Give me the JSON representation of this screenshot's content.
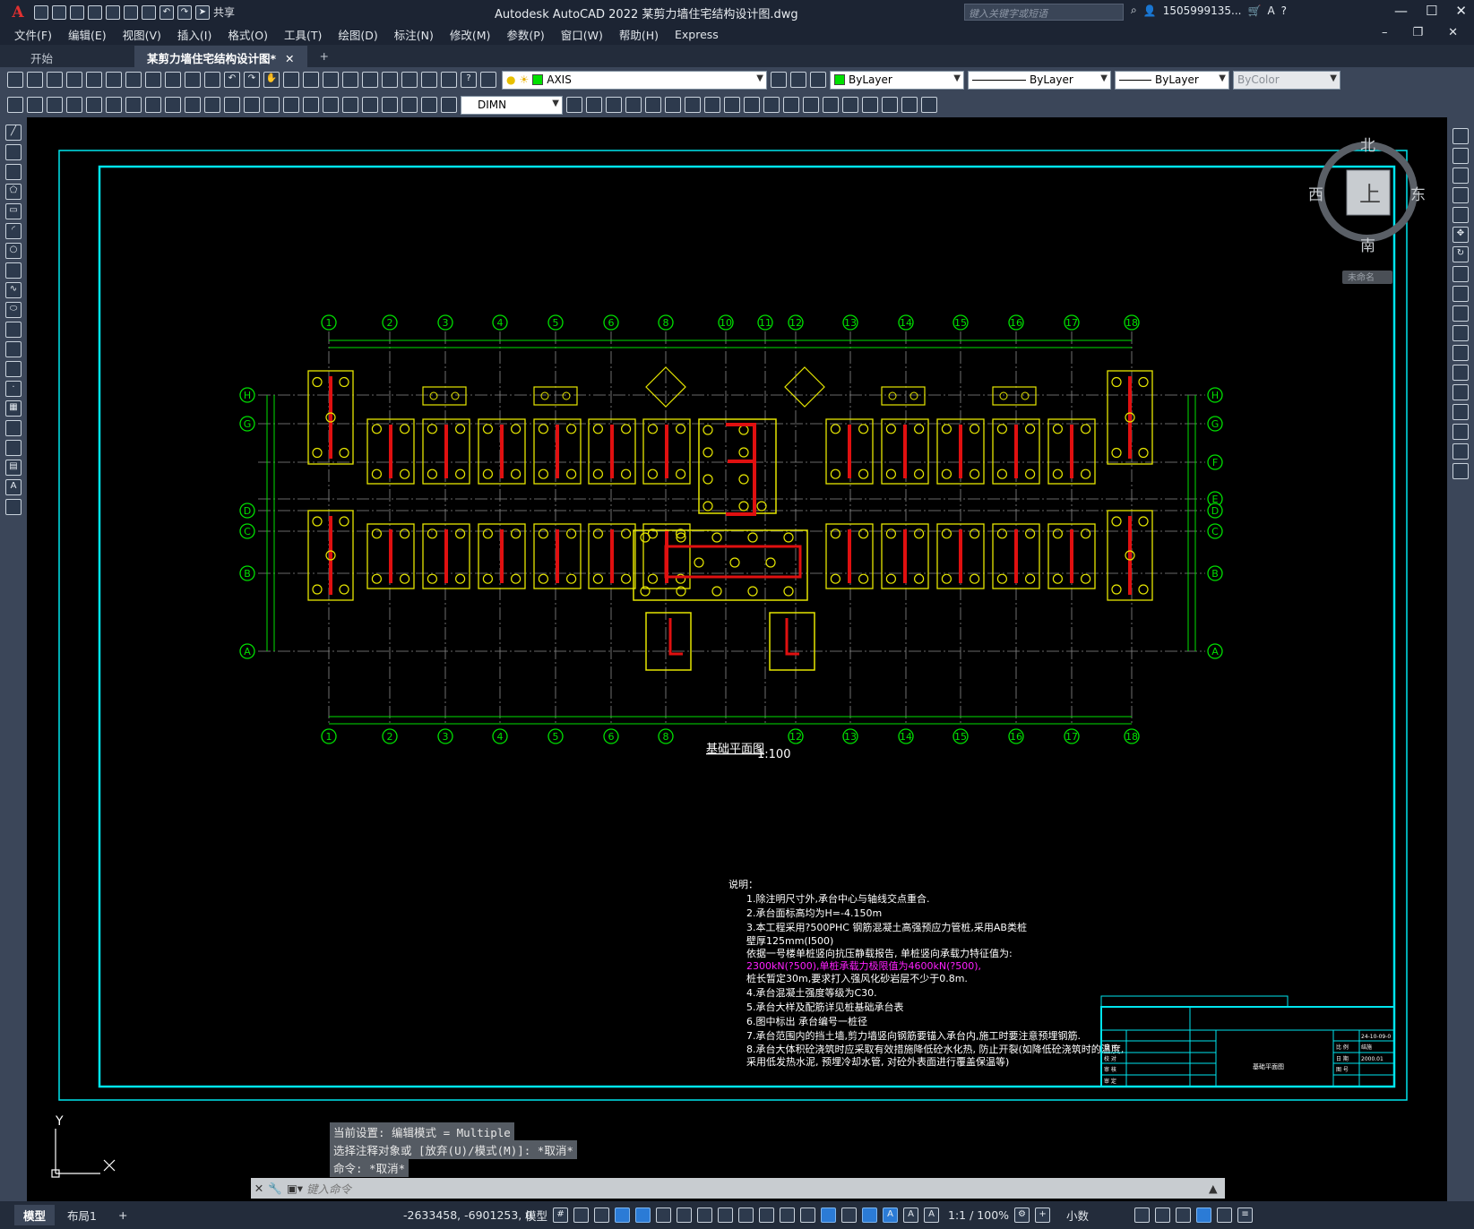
{
  "app": {
    "title": "Autodesk AutoCAD 2022   某剪力墙住宅结构设计图.dwg",
    "logo": "A",
    "share_label": "共享",
    "search_placeholder": "键入关键字或短语",
    "user": "1505999135...",
    "accent": "#2b7bd6"
  },
  "menu": {
    "items": [
      "文件(F)",
      "编辑(E)",
      "视图(V)",
      "插入(I)",
      "格式(O)",
      "工具(T)",
      "绘图(D)",
      "标注(N)",
      "修改(M)",
      "参数(P)",
      "窗口(W)",
      "帮助(H)",
      "Express"
    ]
  },
  "tabs": {
    "start": "开始",
    "active": "某剪力墙住宅结构设计图*",
    "close": "✕",
    "add": "+"
  },
  "toolbar": {
    "layer_name": "AXIS",
    "color": "ByLayer",
    "linetype": "ByLayer",
    "lineweight": "ByLayer",
    "plotstyle": "ByColor",
    "dimstyle": "DIMN"
  },
  "viewcube": {
    "north": "北",
    "south": "南",
    "west": "西",
    "east": "东",
    "top": "上",
    "ucs": "未命名"
  },
  "drawing": {
    "title": "基础平面图",
    "scale": "1:100",
    "grid_top": [
      "1",
      "2",
      "3",
      "4",
      "5",
      "6",
      "8",
      "10",
      "11",
      "12",
      "13",
      "14",
      "15",
      "16",
      "17",
      "18"
    ],
    "grid_bottom": [
      "1",
      "2",
      "3",
      "4",
      "5",
      "6",
      "8",
      "12",
      "13",
      "14",
      "15",
      "16",
      "17",
      "18"
    ],
    "grid_left": [
      "H",
      "G",
      "D",
      "C",
      "B",
      "A"
    ],
    "grid_right": [
      "H",
      "G",
      "F",
      "E",
      "D",
      "C",
      "B",
      "A"
    ],
    "notes_heading": "说明：",
    "notes": [
      "1.除注明尺寸外,承台中心与轴线交点重合.",
      "2.承台面标高均为H=-4.150m",
      "3.本工程采用?500PHC 钢筋混凝土高强预应力管桩,采用AB类桩",
      "  壁厚125mm(I500)",
      "  依据一号楼单桩竖向抗压静载报告, 单桩竖向承载力特征值为:",
      "  2300kN(?500),单桩承载力极限值为4600kN(?500),",
      "  桩长暂定30m,要求打入强风化砂岩层不少于0.8m.",
      "4.承台混凝土强度等级为C30.",
      "5.承台大样及配筋详见桩基础承台表",
      "6.图中标出 承台编号一桩径",
      "7.承台范围内的挡土墙,剪力墙竖向钢筋要锚入承台内,施工时要注意预埋钢筋.",
      "8.承台大体积砼浇筑时应采取有效措施降低砼水化热, 防止开裂(如降低砼浇筑时的温度,",
      "  采用低发热水泥, 预埋冷却水管, 对砼外表面进行覆盖保温等)"
    ],
    "titleblock": {
      "sheet_name": "基础平面图",
      "date": "24-10-09-0",
      "number": "结施",
      "year": "2000.01",
      "labels": [
        "设 计",
        "校 对",
        "审 核",
        "审 定",
        "比 例",
        "日 期",
        "图 号"
      ]
    }
  },
  "command": {
    "history": [
      "当前设置: 编辑模式 = Multiple",
      "选择注释对象或 [放弃(U)/模式(M)]: *取消*",
      "命令: *取消*"
    ],
    "placeholder": "键入命令"
  },
  "status": {
    "tabs": [
      "模型",
      "布局1"
    ],
    "add": "+",
    "coords": "-2633458, -6901253, 0",
    "space": "模型",
    "annotation_scale": "1:1 / 100%",
    "units": "小数"
  }
}
